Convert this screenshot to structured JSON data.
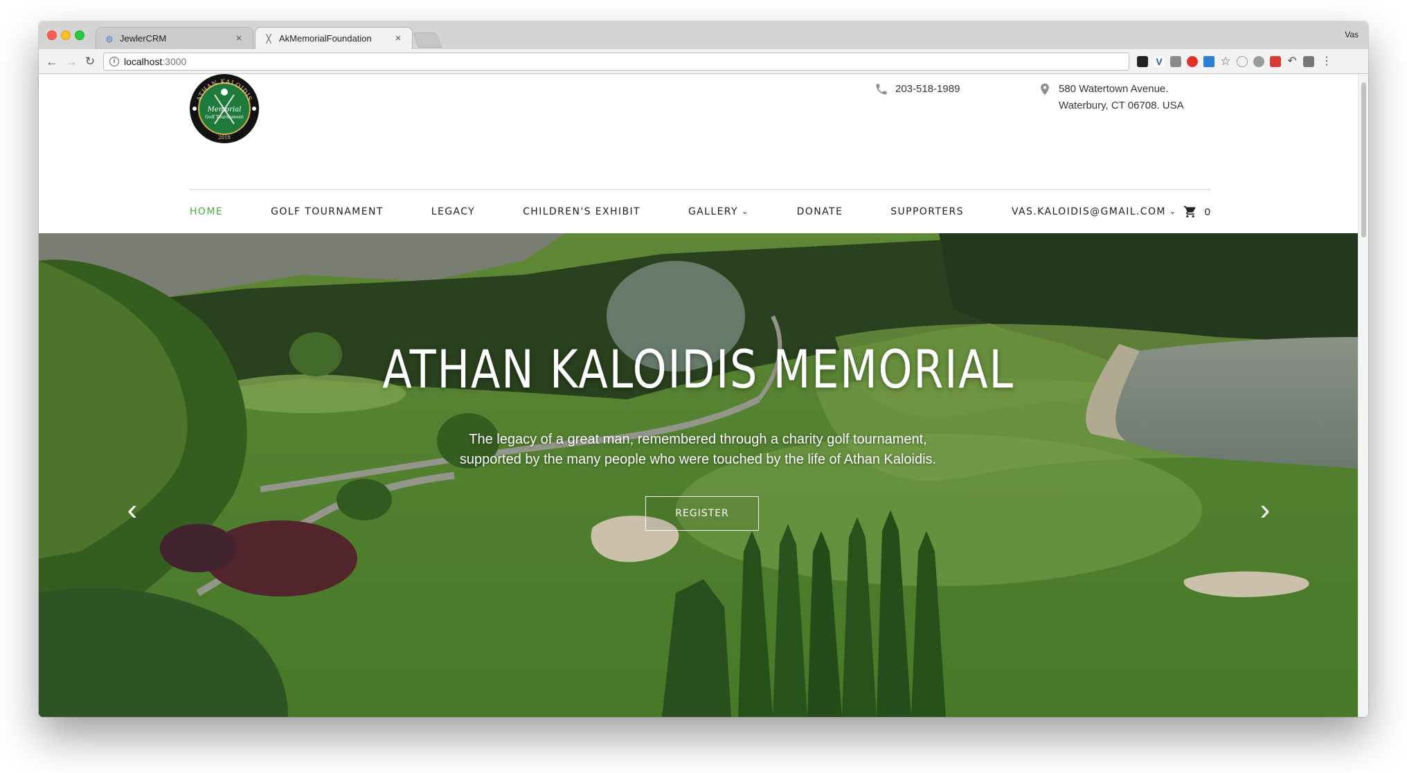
{
  "browser": {
    "tabs": [
      {
        "label": "JewlerCRM",
        "icon": "globe-icon",
        "active": false
      },
      {
        "label": "AkMemorialFoundation",
        "icon": "golf-clubs-icon",
        "active": true
      }
    ],
    "profile_name": "Vas",
    "url_host": "localhost",
    "url_port": ":3000"
  },
  "header": {
    "logo_text": {
      "ring": "ATHAN KALOIDIS",
      "center_line1": "Memorial",
      "center_line2": "Golf Tournament",
      "year": "2018"
    },
    "phone": "203-518-1989",
    "address_line1": "580 Watertown Avenue.",
    "address_line2": "Waterbury, CT 06708. USA"
  },
  "nav": {
    "items": [
      {
        "label": "HOME",
        "active": true,
        "dropdown": false
      },
      {
        "label": "GOLF TOURNAMENT",
        "active": false,
        "dropdown": false
      },
      {
        "label": "LEGACY",
        "active": false,
        "dropdown": false
      },
      {
        "label": "CHILDREN'S EXHIBIT",
        "active": false,
        "dropdown": false
      },
      {
        "label": "GALLERY",
        "active": false,
        "dropdown": true
      },
      {
        "label": "DONATE",
        "active": false,
        "dropdown": false
      },
      {
        "label": "SUPPORTERS",
        "active": false,
        "dropdown": false
      },
      {
        "label": "VAS.KALOIDIS@GMAIL.COM",
        "active": false,
        "dropdown": true
      }
    ],
    "cart_count": "0"
  },
  "hero": {
    "title": "ATHAN KALOIDIS MEMORIAL",
    "subtitle_line1": "The legacy of a great man, remembered through a charity golf tournament,",
    "subtitle_line2": "supported by the many people who were touched by the life of Athan Kaloidis.",
    "register_label": "REGISTER"
  },
  "colors": {
    "accent": "#4ea841",
    "nav_text": "#1e1e1e",
    "logo_green": "#1e7a3a"
  }
}
